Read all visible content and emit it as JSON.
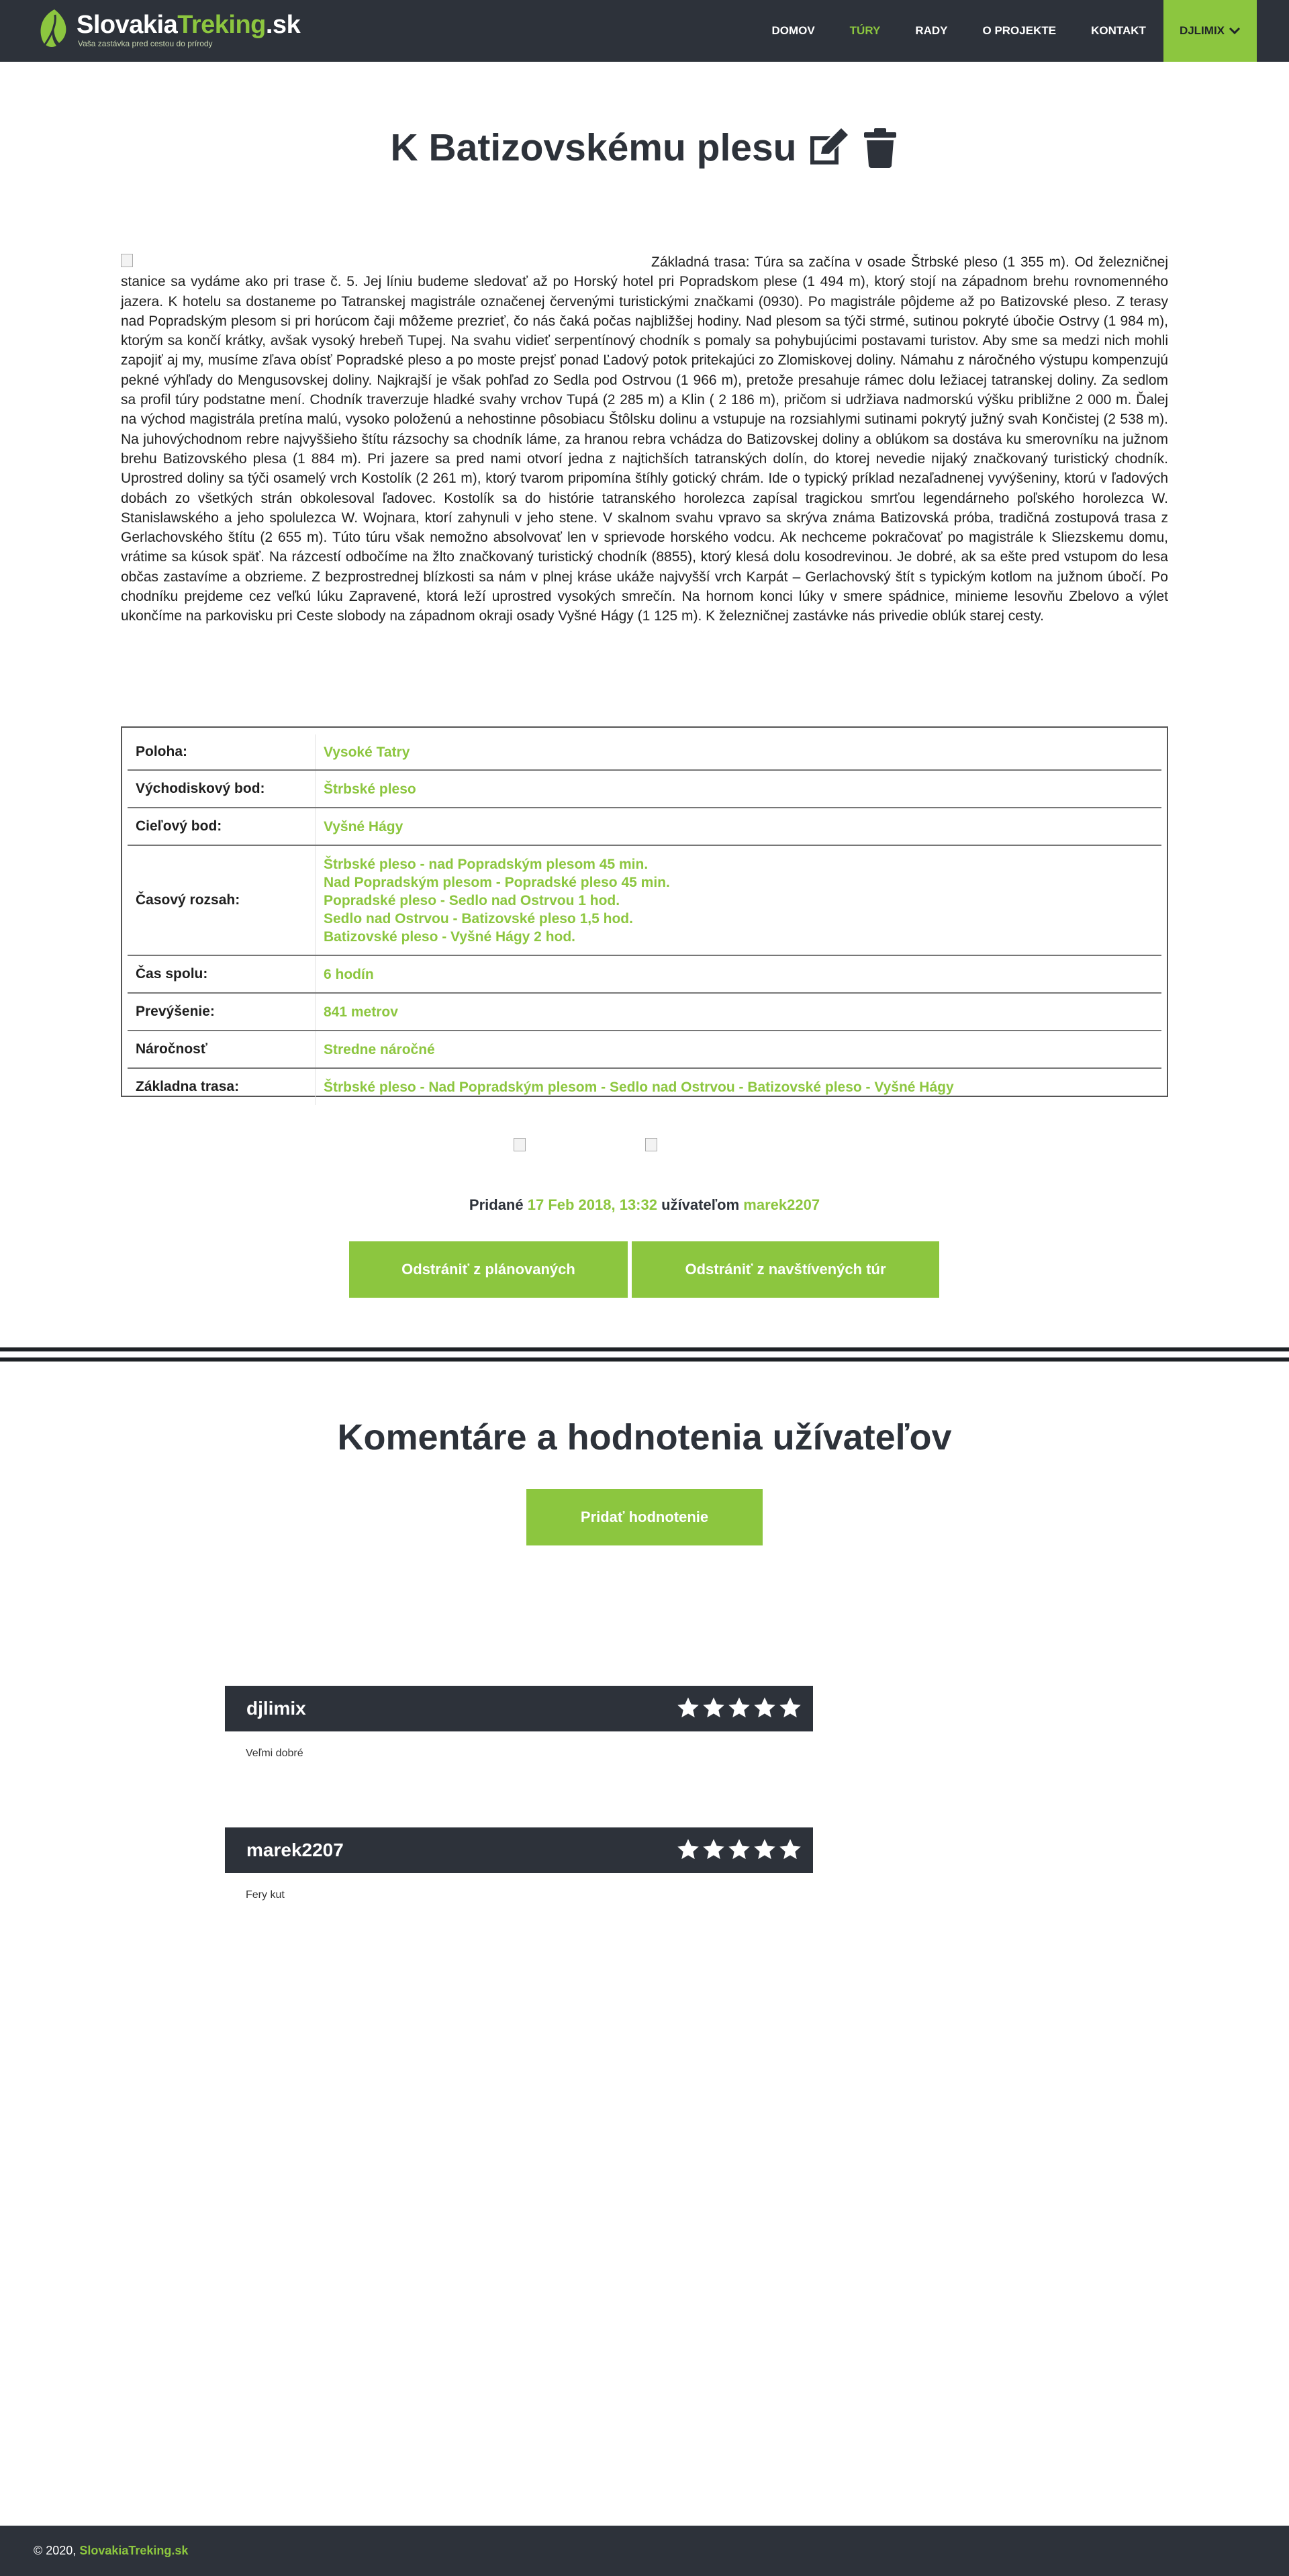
{
  "brand": {
    "name_part1": "Slovakia",
    "name_part2": "Treking",
    "name_part3": ".sk",
    "tagline": "Vaša zastávka pred cestou do prírody",
    "accent_color": "#8cc63f",
    "dark_color": "#2d323a"
  },
  "nav": {
    "items": [
      {
        "label": "Domov"
      },
      {
        "label": "Túry"
      },
      {
        "label": "Rady"
      },
      {
        "label": "O projekte"
      },
      {
        "label": "Kontakt"
      }
    ],
    "active": "Túry",
    "user": "djlimix",
    "user_icon": "chevron-down-icon"
  },
  "page": {
    "title": "K Batizovskému plesu",
    "edit_icon": "edit-icon",
    "delete_icon": "trash-icon",
    "description": "Základná trasa: Túra sa začína v osade Štrbské pleso (1 355 m). Od železničnej stanice sa vydáme ako pri trase č. 5. Jej líniu budeme sledovať až po Horský hotel pri Popradskom plese (1 494 m), ktorý stojí na západnom brehu rovnomenného jazera. K hotelu sa dostaneme po Tatranskej magistrále označenej červenými turistickými značkami (0930). Po magistrále pôjdeme až po Batizovské pleso. Z terasy nad Popradským plesom si pri horúcom čaji môžeme prezrieť, čo nás čaká počas najbližšej hodiny. Nad plesom sa týči strmé, sutinou pokryté úbočie Ostrvy (1 984 m), ktorým sa končí krátky, avšak vysoký hrebeň Tupej. Na svahu vidieť serpentínový chodník s pomaly sa pohybujúcimi postavami turistov. Aby sme sa medzi nich mohli zapojiť aj my, musíme zľava obísť Popradské pleso a po moste prejsť ponad Ľadový potok pritekajúci zo Zlomiskovej doliny. Námahu z náročného výstupu kompenzujú pekné výhľady do Mengusovskej doliny. Najkrajší je však pohľad zo Sedla pod Ostrvou (1 966 m), pretože presahuje rámec dolu ležiacej tatranskej doliny. Za sedlom sa profil túry podstatne mení. Chodník traverzuje hladké svahy vrchov Tupá (2 285 m) a Klin ( 2 186 m), pričom si udržiava nadmorskú výšku približne 2 000 m. Ďalej na východ magistrála pretína malú, vysoko položenú a nehostinne pôsobiacu Štôlsku dolinu a vstupuje na rozsiahlymi sutinami pokrytý južný svah Končistej (2 538 m). Na juhovýchodnom rebre najvyššieho štítu rázsochy sa chodník láme, za hranou rebra vchádza do Batizovskej doliny a oblúkom sa dostáva ku smerovníku na južnom brehu Batizovského plesa (1 884 m). Pri jazere sa pred nami otvorí jedna z najtichších tatranských dolín, do ktorej nevedie nijaký značkovaný turistický chodník. Uprostred doliny sa týči osamelý vrch Kostolík (2 261 m), ktorý tvarom pripomína štíhly gotický chrám. Ide o typický príklad nezaľadnenej vyvýšeniny, ktorú v ľadových dobách zo všetkých strán obkolesoval ľadovec. Kostolík sa do histórie tatranského horolezca zapísal tragickou smrťou legendárneho poľského horolezca W. Stanislawského a jeho spolulezca W. Wojnara, ktorí zahynuli v jeho stene. V skalnom svahu vpravo sa skrýva známa Batizovská próba, tradičná zostupová trasa z Gerlachovského štítu (2 655 m). Túto túru však nemožno absolvovať len v sprievode horského vodcu. Ak nechceme pokračovať po magistrále k Sliezskemu domu, vrátime sa kúsok späť. Na rázcestí odbočíme na žlto značkovaný turistický chodník (8855), ktorý klesá dolu kosodrevinou. Je dobré, ak sa ešte pred vstupom do lesa občas zastavíme a obzrieme. Z bezprostrednej blízkosti sa nám v plnej kráse ukáže najvyšší vrch Karpát – Gerlachovský štít s typickým kotlom na južnom úbočí. Po chodníku prejdeme cez veľkú lúku Zapravené, ktorá leží uprostred vysokých smrečín. Na hornom konci lúky v smere spádnice, minieme lesovňu Zbelovo a výlet ukončíme na parkovisku pri Ceste slobody na západnom okraji osady Vyšné Hágy (1 125 m). K železničnej zastávke nás privedie oblúk starej cesty."
  },
  "info": {
    "rows": [
      {
        "label": "Poloha:",
        "value": [
          "Vysoké Tatry"
        ]
      },
      {
        "label": "Východiskový bod:",
        "value": [
          "Štrbské pleso"
        ]
      },
      {
        "label": "Cieľový bod:",
        "value": [
          "Vyšné Hágy"
        ]
      },
      {
        "label": "Časový rozsah:",
        "value": [
          "Štrbské pleso - nad Popradským plesom 45 min.",
          "Nad Popradským plesom - Popradské pleso 45 min.",
          "Popradské pleso - Sedlo nad Ostrvou 1 hod.",
          "Sedlo nad Ostrvou - Batizovské pleso 1,5 hod.",
          "Batizovské pleso - Vyšné Hágy 2 hod."
        ]
      },
      {
        "label": "Čas spolu:",
        "value": [
          "6 hodín"
        ]
      },
      {
        "label": "Prevýšenie:",
        "value": [
          "841 metrov"
        ]
      },
      {
        "label": "Náročnosť",
        "value": [
          "Stredne náročné"
        ]
      },
      {
        "label": "Základna trasa:",
        "value": [
          "Štrbské pleso - Nad Popradským plesom - Sedlo nad Ostrvou - Batizovské pleso - Vyšné Hágy"
        ]
      }
    ]
  },
  "added": {
    "prefix": "Pridané",
    "date": "17 Feb 2018, 13:32",
    "middle": "užívateľom",
    "user": "marek2207"
  },
  "actions": {
    "remove_planned": "Odstrániť z plánovaných",
    "remove_visited": "Odstrániť z navštívených túr"
  },
  "comments": {
    "title": "Komentáre a hodnotenia užívateľov",
    "add_button": "Pridať hodnotenie",
    "items": [
      {
        "user": "djlimix",
        "rating": 5,
        "text": "Veľmi dobré"
      },
      {
        "user": "marek2207",
        "rating": 5,
        "text": "Fery kut"
      }
    ]
  },
  "footer": {
    "copyright": "© 2020, ",
    "site": "SlovakiaTreking.sk"
  }
}
